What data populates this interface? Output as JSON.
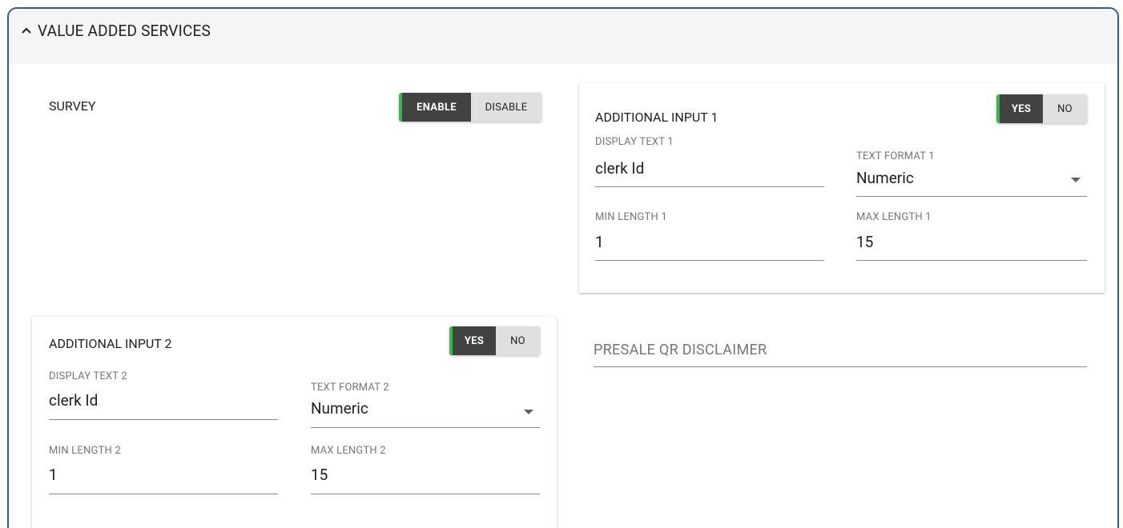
{
  "section": {
    "title": "VALUE ADDED SERVICES"
  },
  "survey": {
    "label": "SURVEY",
    "enable_label": "ENABLE",
    "disable_label": "DISABLE",
    "selected": "ENABLE"
  },
  "input1": {
    "title": "ADDITIONAL INPUT 1",
    "yes_label": "YES",
    "no_label": "NO",
    "selected": "YES",
    "display_text_label": "DISPLAY TEXT 1",
    "display_text_value": "clerk Id",
    "text_format_label": "TEXT FORMAT 1",
    "text_format_value": "Numeric",
    "min_length_label": "MIN LENGTH 1",
    "min_length_value": "1",
    "max_length_label": "MAX LENGTH 1",
    "max_length_value": "15"
  },
  "input2": {
    "title": "ADDITIONAL INPUT 2",
    "yes_label": "YES",
    "no_label": "NO",
    "selected": "YES",
    "display_text_label": "DISPLAY TEXT 2",
    "display_text_value": "clerk Id",
    "text_format_label": "TEXT FORMAT 2",
    "text_format_value": "Numeric",
    "min_length_label": "MIN LENGTH 2",
    "min_length_value": "1",
    "max_length_label": "MAX LENGTH 2",
    "max_length_value": "15"
  },
  "presale": {
    "placeholder": "PRESALE QR DISCLAIMER"
  },
  "colors": {
    "border": "#2f5d8c",
    "toggle_accent": "#3cb54a",
    "toggle_active_bg": "#424242",
    "toggle_inactive_bg": "#e0e0e0"
  },
  "icons": {
    "collapse": "chevron-up-icon",
    "dropdown": "caret-down-icon"
  }
}
